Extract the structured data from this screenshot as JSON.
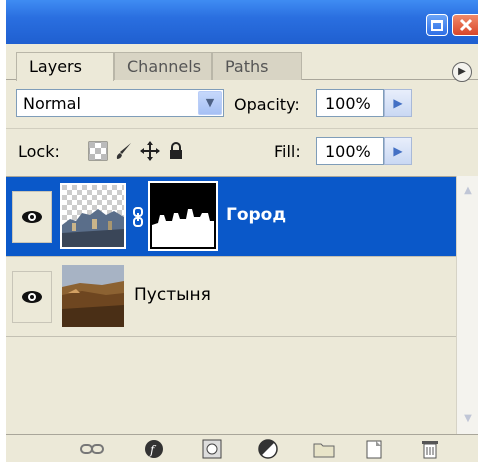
{
  "tabs": [
    {
      "label": "Layers",
      "active": true
    },
    {
      "label": "Channels",
      "active": false
    },
    {
      "label": "Paths",
      "active": false
    }
  ],
  "blend_mode": "Normal",
  "opacity": {
    "label": "Opacity:",
    "value": "100%"
  },
  "lock": {
    "label": "Lock:",
    "icons": [
      "lock-transparent-icon",
      "lock-brush-icon",
      "lock-move-icon",
      "lock-all-icon"
    ]
  },
  "fill": {
    "label": "Fill:",
    "value": "100%"
  },
  "layers": [
    {
      "name": "Город",
      "selected": true,
      "visible": true,
      "has_mask": true
    },
    {
      "name": "Пустыня",
      "selected": false,
      "visible": true,
      "has_mask": false
    }
  ],
  "toolbar_icons": [
    "link-layers-icon",
    "layer-style-icon",
    "add-mask-icon",
    "adjustment-layer-icon",
    "new-group-icon",
    "new-layer-icon",
    "delete-layer-icon"
  ],
  "colors": {
    "selection": "#0a58c9",
    "titlebar": "#2a6fe0",
    "panel": "#ece9d8"
  }
}
